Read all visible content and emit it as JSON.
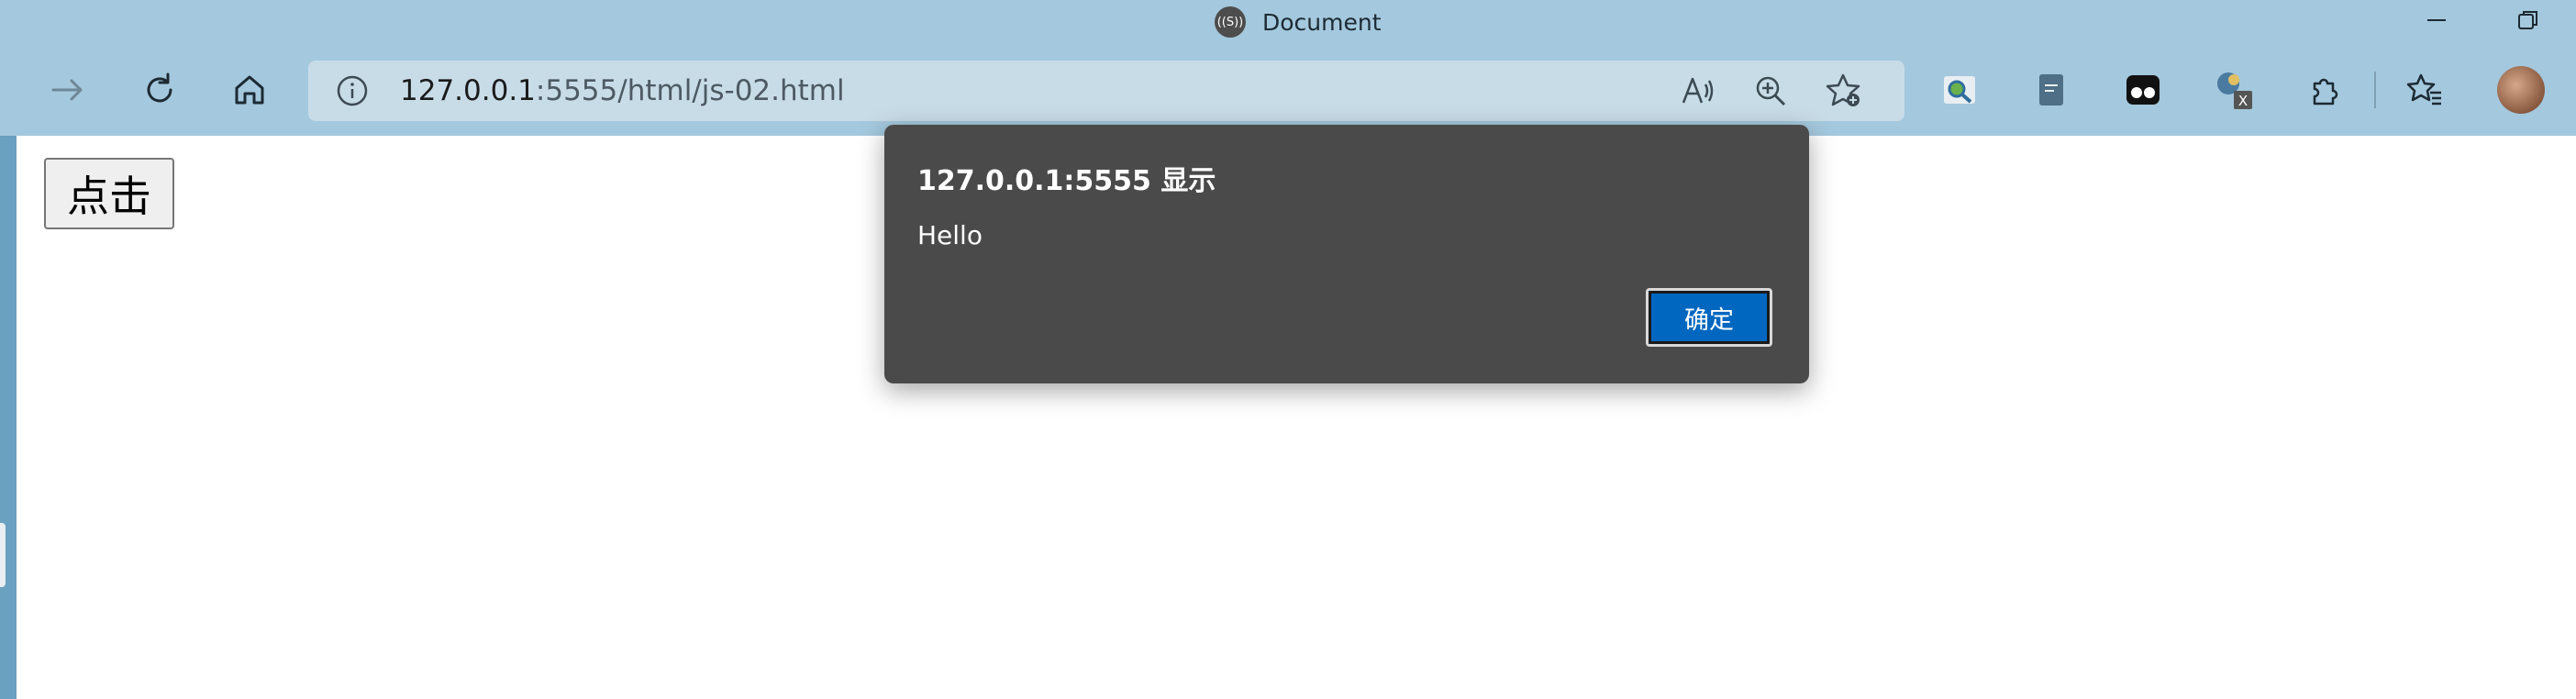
{
  "window": {
    "title": "Document",
    "favicon_text": "((S))"
  },
  "toolbar": {
    "icons": [
      "back-arrow-icon",
      "refresh-icon",
      "home-icon"
    ],
    "address": {
      "host": "127.0.0.1",
      "rest": ":5555/html/js-02.html"
    },
    "address_icons": [
      "site-info-icon",
      "read-aloud-icon",
      "zoom-icon",
      "add-favorite-icon"
    ],
    "extension_icons": [
      "search-extension-icon",
      "notes-extension-icon",
      "glasses-extension-icon",
      "translate-extension-icon",
      "extensions-icon",
      "favorites-icon"
    ]
  },
  "page": {
    "button_label": "点击"
  },
  "dialog": {
    "title": "127.0.0.1:5555 显示",
    "message": "Hello",
    "ok_label": "确定"
  },
  "colors": {
    "chrome_bg": "#a4c8dd",
    "dialog_bg": "#4a4a4a",
    "accent": "#0067c0"
  }
}
